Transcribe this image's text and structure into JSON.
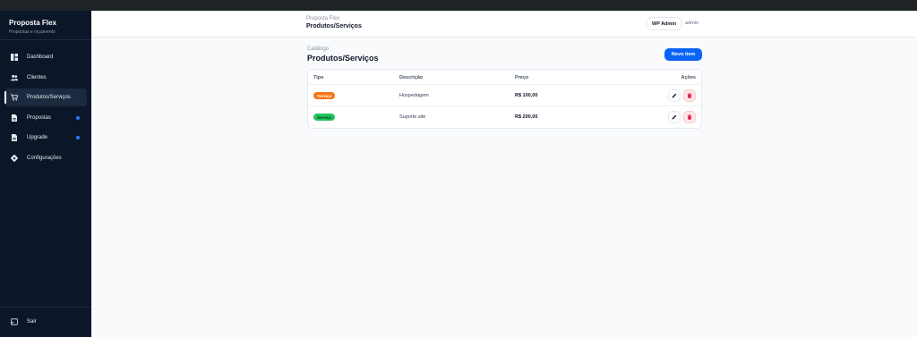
{
  "sidebar": {
    "brand_title": "Proposta Flex",
    "brand_subtitle": "Propostas e orçamento",
    "items": [
      {
        "label": "Dashboard",
        "icon": "dashboard-icon",
        "active": false,
        "dot": false
      },
      {
        "label": "Clientes",
        "icon": "users-icon",
        "active": false,
        "dot": false
      },
      {
        "label": "Produtos/Serviços",
        "icon": "cart-icon",
        "active": true,
        "dot": false
      },
      {
        "label": "Propostas",
        "icon": "document-icon",
        "active": false,
        "dot": true
      },
      {
        "label": "Upgrade",
        "icon": "document-icon",
        "active": false,
        "dot": true
      },
      {
        "label": "Configurações",
        "icon": "gear-icon",
        "active": false,
        "dot": false
      }
    ],
    "logout_label": "Sair"
  },
  "header": {
    "app_name": "Proposta Flex",
    "title": "Produtos/Serviços",
    "wp_admin_label": "WP Admin",
    "user": "admin"
  },
  "main": {
    "crumb": "Catálogo",
    "title": "Produtos/Serviços",
    "new_button": "Novo item",
    "table": {
      "headers": {
        "type": "Tipo",
        "description": "Descrição",
        "price": "Preço",
        "actions": "Ações"
      },
      "rows": [
        {
          "type": "Serviço",
          "type_color": "#f97316",
          "description": "Hospedagem",
          "price": "R$ 100,00"
        },
        {
          "type": "Serviço",
          "type_color": "#22c55e",
          "description": "Suporte site",
          "price": "R$ 200,00"
        }
      ]
    }
  },
  "colors": {
    "accent": "#0b63f6",
    "sidebar_bg": "#0b1628",
    "danger": "#e11d48"
  }
}
